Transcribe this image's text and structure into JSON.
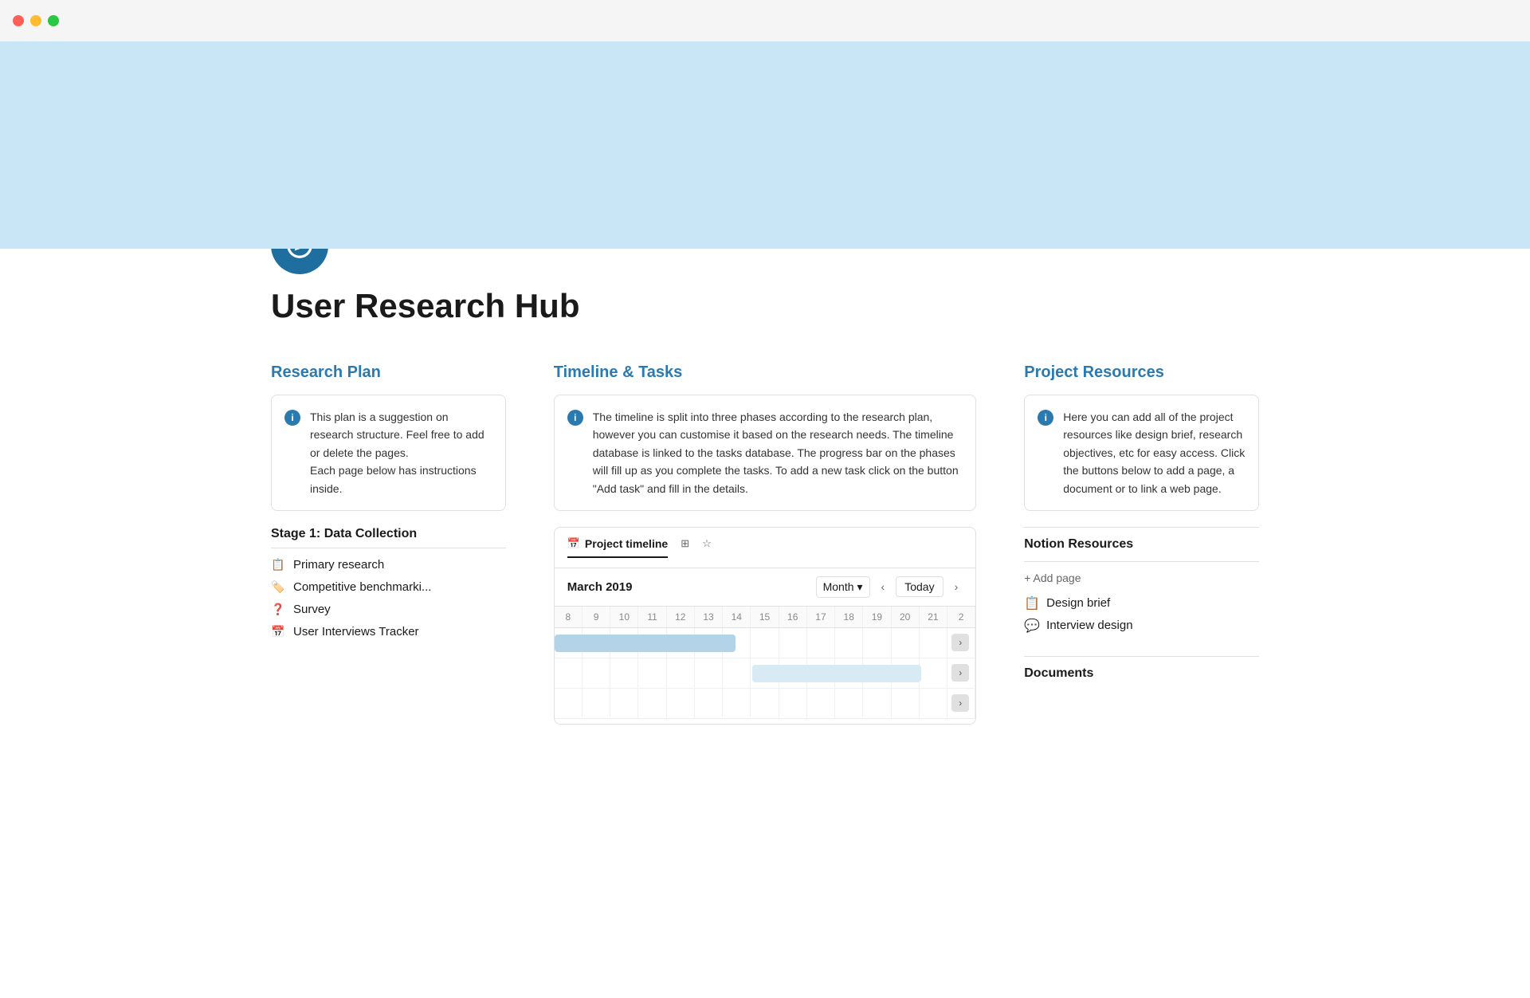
{
  "titleBar": {
    "trafficLights": [
      "red",
      "yellow",
      "green"
    ]
  },
  "page": {
    "title": "User Research Hub",
    "iconAlt": "compass icon"
  },
  "researchPlan": {
    "heading": "Research Plan",
    "infoBox": {
      "text": "This plan is a suggestion on research structure. Feel free to add or delete the pages.\nEach page below has instructions inside."
    },
    "stage1": {
      "heading": "Stage 1: Data Collection",
      "items": [
        {
          "label": "Primary research",
          "icon": "📋"
        },
        {
          "label": "Competitive benchmarki...",
          "icon": "🏷️"
        },
        {
          "label": "Survey",
          "icon": "❓"
        },
        {
          "label": "User Interviews Tracker",
          "icon": "📅"
        }
      ]
    }
  },
  "timeline": {
    "heading": "Timeline & Tasks",
    "infoBox": {
      "text": "The timeline is split into three phases according to the research plan, however you can customise it based on the research needs. The timeline database is linked to the tasks database. The progress bar on the phases will fill up as you complete the tasks. To add a new task click on the button \"Add task\" and fill in the details."
    },
    "tabs": [
      {
        "label": "Project timeline",
        "icon": "📅",
        "active": true
      },
      {
        "label": "grid",
        "icon": "⊞",
        "active": false
      },
      {
        "label": "star",
        "icon": "☆",
        "active": false
      }
    ],
    "currentDate": "March 2019",
    "viewMode": "Month",
    "gridNumbers": [
      "8",
      "9",
      "10",
      "11",
      "12",
      "13",
      "14",
      "15",
      "16",
      "17",
      "18",
      "19",
      "20",
      "21",
      "2"
    ],
    "todayLabel": "Today"
  },
  "projectResources": {
    "heading": "Project Resources",
    "infoBox": {
      "text": "Here you can add all of the project resources like design brief, research objectives, etc for easy access. Click the buttons below to add a page, a document or to link a web page."
    },
    "notionResources": {
      "heading": "Notion Resources",
      "addPageLabel": "+ Add page",
      "links": [
        {
          "label": "Design brief",
          "icon": "📋"
        },
        {
          "label": "Interview design",
          "icon": "💬"
        }
      ]
    },
    "documents": {
      "heading": "Documents"
    }
  }
}
